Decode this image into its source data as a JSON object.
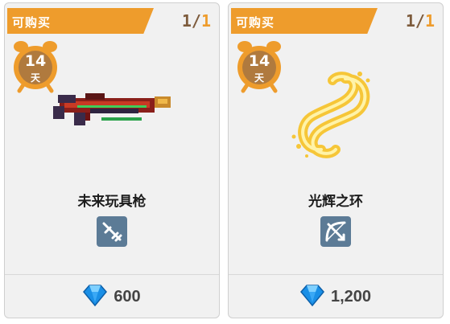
{
  "cards": [
    {
      "status_label": "可购买",
      "stock": {
        "current": "1",
        "separator": "/",
        "max": "1"
      },
      "timer": {
        "days": "14",
        "unit": "天"
      },
      "item_name": "未来玩具枪",
      "item_icon": "pixel-rifle",
      "type_icon": "weapon-gun-icon",
      "price": "600",
      "currency_icon": "blue-gem-icon"
    },
    {
      "status_label": "可购买",
      "stock": {
        "current": "1",
        "separator": "/",
        "max": "1"
      },
      "timer": {
        "days": "14",
        "unit": "天"
      },
      "item_name": "光辉之环",
      "item_icon": "radiant-ring",
      "type_icon": "weapon-bow-icon",
      "price": "1,200",
      "currency_icon": "blue-gem-icon"
    }
  ],
  "colors": {
    "banner": "#ee9c2c",
    "stock_current": "#7d5b3c",
    "stock_max": "#ee9c2c",
    "timer_badge": "#b07a3e",
    "type_badge": "#5c7b96",
    "gem": "#1a8fe6"
  }
}
